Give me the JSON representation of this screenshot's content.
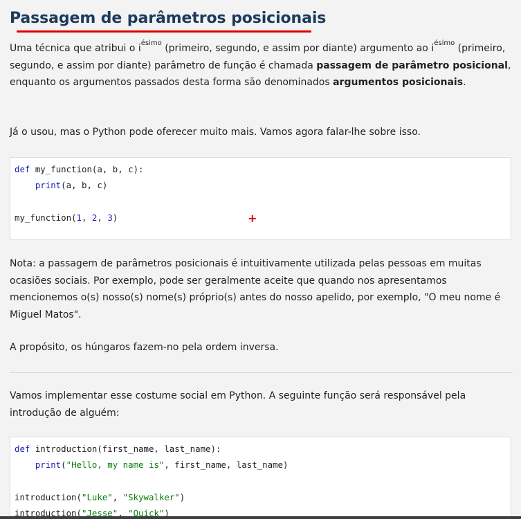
{
  "title": "Passagem de parâmetros posicionais",
  "p1": {
    "t1": "Uma técnica que atribui o i",
    "sup1": "ésimo",
    "t2": " (primeiro, segundo, e assim por diante) argumento ao i",
    "sup2": "ésimo",
    "t3": " (primeiro, segundo, e assim por diante) parâmetro de função é chamada ",
    "b1": "passagem de parâmetro posicional",
    "t4": ", enquanto os argumentos passados desta forma são denominados ",
    "b2": "argumentos posicionais",
    "t5": "."
  },
  "p2": "Já o usou, mas o Python pode oferecer muito mais. Vamos agora falar-lhe sobre isso.",
  "code1": {
    "l1_kw": "def",
    "l1_rest": " my_function(a, b, c):",
    "l2_indent": "    ",
    "l2_fn": "print",
    "l2_rest": "(a, b, c)",
    "l4_a": "my_function(",
    "l4_n1": "1",
    "l4_s1": ", ",
    "l4_n2": "2",
    "l4_s2": ", ",
    "l4_n3": "3",
    "l4_end": ")"
  },
  "p3": "Nota: a passagem de parâmetros posicionais é intuitivamente utilizada pelas pessoas em muitas ocasiões sociais. Por exemplo, pode ser geralmente aceite que quando nos apresentamos mencionemos o(s) nosso(s) nome(s) próprio(s) antes do nosso apelido, por exemplo, \"O meu nome é Miguel Matos\".",
  "p4": "A propósito, os húngaros fazem-no pela ordem inversa.",
  "p5": "Vamos implementar esse costume social em Python. A seguinte função será responsável pela introdução de alguém:",
  "code2": {
    "l1_kw": "def",
    "l1_rest": " introduction(first_name, last_name):",
    "l2_indent": "    ",
    "l2_fn": "print",
    "l2_open": "(",
    "l2_str": "\"Hello, my name is\"",
    "l2_rest": ", first_name, last_name)",
    "l4_a": "introduction(",
    "l4_s1": "\"Luke\"",
    "l4_mid": ", ",
    "l4_s2": "\"Skywalker\"",
    "l4_end": ")",
    "l5_a": "introduction(",
    "l5_s1": "\"Jesse\"",
    "l5_mid": ", ",
    "l5_s2": "\"Quick\"",
    "l5_end": ")"
  },
  "cursor_glyph": "+",
  "colors": {
    "heading": "#1b3a5c",
    "underline": "#e00000",
    "keyword": "#1e1eb4",
    "string": "#0a7a0a"
  }
}
